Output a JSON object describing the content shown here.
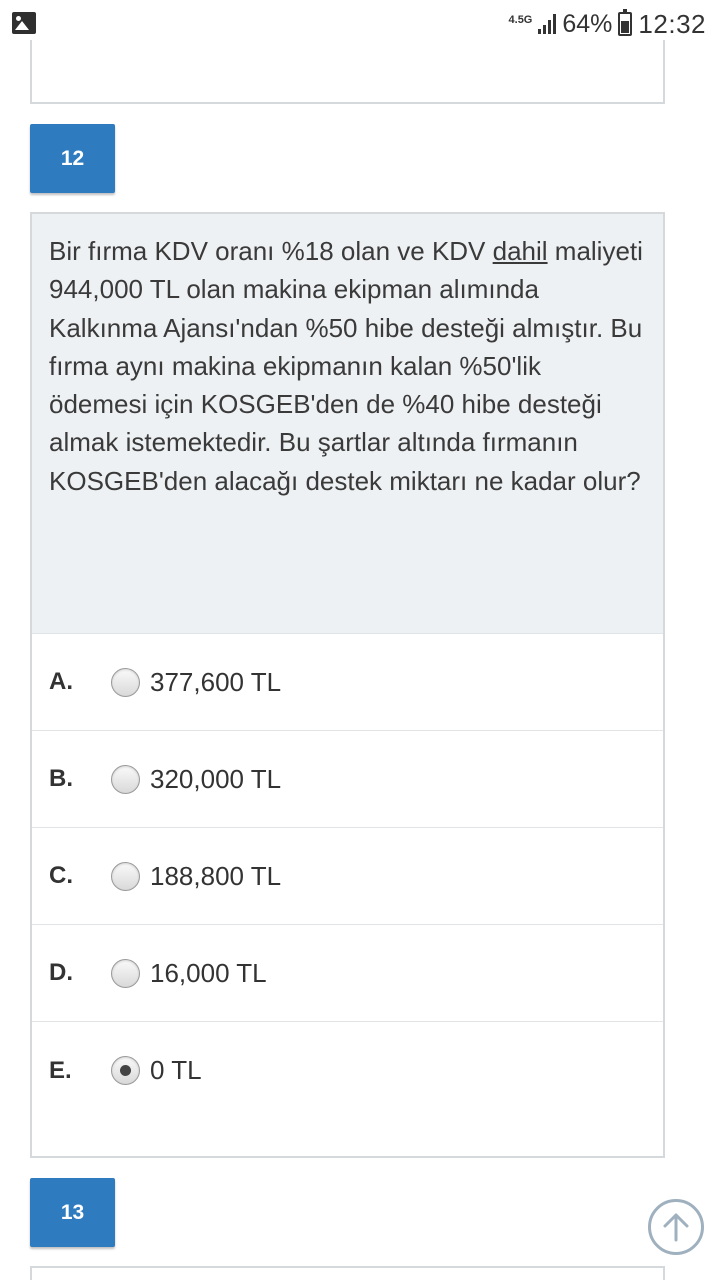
{
  "status_bar": {
    "network": "4.5G",
    "battery_pct": "64%",
    "time": "12:32"
  },
  "question_12": {
    "number": "12",
    "text_before_underline": "Bir fırma KDV oranı %18 olan ve KDV ",
    "text_underlined": "dahil",
    "text_after_underline": " maliyeti 944,000 TL olan makina ekipman alımında Kalkınma Ajansı'ndan %50 hibe desteği almıştır. Bu fırma aynı makina ekipmanın kalan %50'lik ödemesi için KOSGEB'den de %40 hibe desteği almak istemektedir. Bu şartlar altında fırmanın KOSGEB'den alacağı destek miktarı ne kadar olur?",
    "options": [
      {
        "letter": "A.",
        "label": "377,600 TL",
        "selected": false
      },
      {
        "letter": "B.",
        "label": "320,000 TL",
        "selected": false
      },
      {
        "letter": "C.",
        "label": "188,800 TL",
        "selected": false
      },
      {
        "letter": "D.",
        "label": "16,000 TL",
        "selected": false
      },
      {
        "letter": "E.",
        "label": "0 TL",
        "selected": true
      }
    ]
  },
  "question_13": {
    "number": "13"
  },
  "colors": {
    "accent": "#2f7bbf",
    "question_bg": "#eef1f3",
    "border": "#d6d9dc"
  },
  "icons": {
    "gallery": "gallery-icon",
    "signal": "signal-icon",
    "battery": "battery-icon",
    "scroll_top": "arrow-up-circle-icon"
  }
}
